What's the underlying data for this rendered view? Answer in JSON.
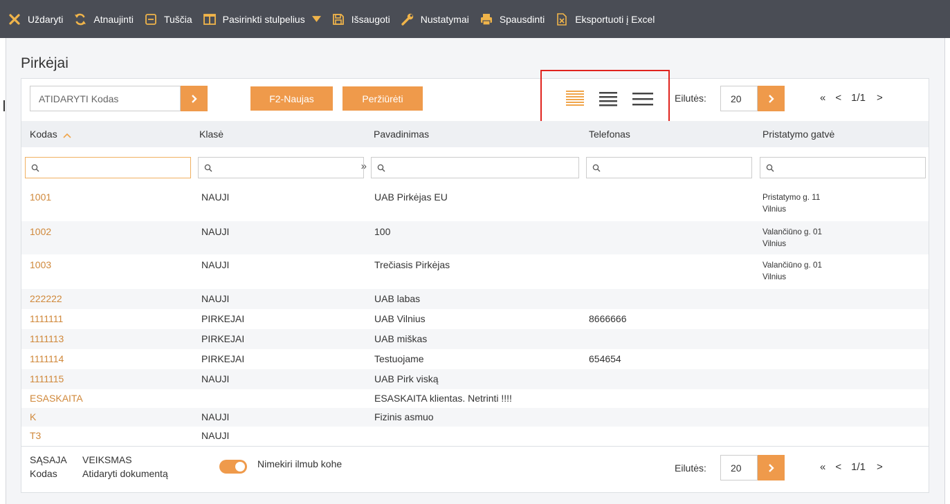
{
  "toolbar": {
    "close_label": "Uždaryti",
    "refresh_label": "Atnaujinti",
    "empty_label": "Tuščia",
    "columns_label": "Pasirinkti stulpelius",
    "save_label": "Išsaugoti",
    "settings_label": "Nustatymai",
    "print_label": "Spausdinti",
    "export_label": "Eksportuoti į Excel"
  },
  "page": {
    "title": "Pirkėjai"
  },
  "controls": {
    "open_placeholder": "ATIDARYTI Kodas",
    "new_button": "F2-Naujas",
    "view_button": "Peržiūrėti",
    "rows_label": "Eilutės:",
    "rows_value": "20",
    "page_info": "1/1",
    "first_page": "«",
    "prev_page": "<",
    "next_page": ">"
  },
  "table": {
    "headers": [
      "Kodas",
      "Klasė",
      "Pavadinimas",
      "Telefonas",
      "Pristatymo gatvė"
    ],
    "filter_scroll": "»",
    "rows": [
      {
        "code": "1001",
        "class": "NAUJI",
        "name": "UAB Pirkėjas EU",
        "phone": "",
        "street": "Pristatymo g. 11",
        "city": "Vilnius"
      },
      {
        "code": "1002",
        "class": "NAUJI",
        "name": "100",
        "phone": "",
        "street": "Valančiūno g. 01",
        "city": "Vilnius"
      },
      {
        "code": "1003",
        "class": "NAUJI",
        "name": "Trečiasis Pirkėjas",
        "phone": "",
        "street": "Valančiūno g. 01",
        "city": "Vilnius"
      },
      {
        "code": "222222",
        "class": "NAUJI",
        "name": "UAB labas",
        "phone": "",
        "street": "",
        "city": ""
      },
      {
        "code": "1111111",
        "class": "PIRKEJAI",
        "name": "UAB Vilnius",
        "phone": "8666666",
        "street": "",
        "city": ""
      },
      {
        "code": "1111113",
        "class": "PIRKEJAI",
        "name": "UAB miškas",
        "phone": "",
        "street": "",
        "city": ""
      },
      {
        "code": "1111114",
        "class": "PIRKEJAI",
        "name": "Testuojame",
        "phone": "654654",
        "street": "",
        "city": ""
      },
      {
        "code": "1111115",
        "class": "NAUJI",
        "name": "UAB Pirk viską",
        "phone": "",
        "street": "",
        "city": ""
      },
      {
        "code": "ESASKAITA",
        "class": "",
        "name": "ESASKAITA klientas. Netrinti !!!!",
        "phone": "",
        "street": "",
        "city": ""
      },
      {
        "code": "K",
        "class": "NAUJI",
        "name": "Fizinis asmuo",
        "phone": "",
        "street": "",
        "city": ""
      },
      {
        "code": "T3",
        "class": "NAUJI",
        "name": "",
        "phone": "",
        "street": "",
        "city": ""
      }
    ]
  },
  "footer": {
    "col1_top": "SĄSAJA",
    "col1_bottom": "Kodas",
    "col2_top": "VEIKSMAS",
    "col2_bottom": "Atidaryti dokumentą",
    "toggle_label": "Nimekiri ilmub kohe",
    "rows_label": "Eilutės:",
    "rows_value": "20",
    "page_info": "1/1"
  }
}
